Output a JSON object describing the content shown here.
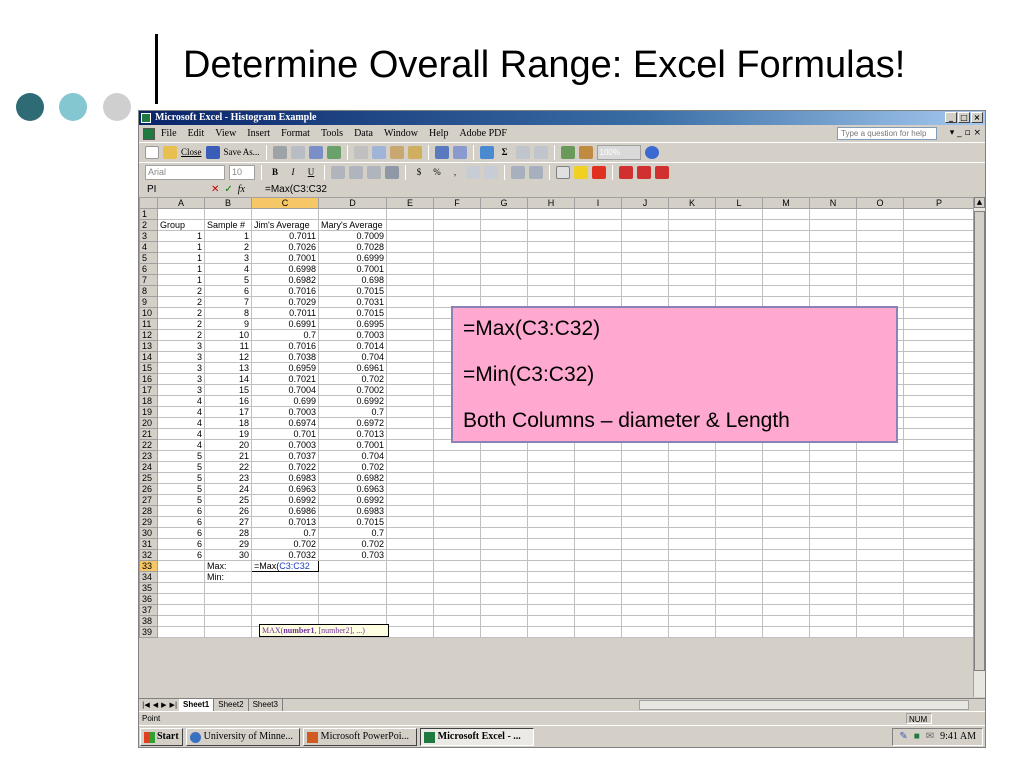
{
  "slide": {
    "title": "Determine Overall Range: Excel Formulas!",
    "dot_colors": [
      "#2e6b74",
      "#85c7d0",
      "#cfcfcf"
    ]
  },
  "window": {
    "title": "Microsoft Excel - Histogram Example",
    "controls": [
      "_",
      "□",
      "×"
    ]
  },
  "menu": {
    "items": [
      "File",
      "Edit",
      "View",
      "Insert",
      "Format",
      "Tools",
      "Data",
      "Window",
      "Help",
      "Adobe PDF"
    ],
    "help_placeholder": "Type a question for help"
  },
  "toolbar": {
    "close_label": "Close",
    "saveas_label": "Save As...",
    "zoom": "100%",
    "font_name": "Arial",
    "font_size": "10",
    "bold": "B",
    "italic": "I",
    "underline": "U",
    "currency": "$",
    "percent": "%",
    "comma": ",",
    "sum": "Σ"
  },
  "formula_bar": {
    "name_box": "PI",
    "fx": "fx",
    "formula": "=Max(C3:C32"
  },
  "grid": {
    "columns": [
      "A",
      "B",
      "C",
      "D",
      "E",
      "F",
      "G",
      "H",
      "I",
      "J",
      "K",
      "L",
      "M",
      "N",
      "O",
      "P"
    ],
    "headers": [
      "Group",
      "Sample #",
      "Jim's Average",
      "Mary's Average"
    ],
    "rows": [
      [
        "1",
        "1",
        "0.7011",
        "0.7009"
      ],
      [
        "1",
        "2",
        "0.7026",
        "0.7028"
      ],
      [
        "1",
        "3",
        "0.7001",
        "0.6999"
      ],
      [
        "1",
        "4",
        "0.6998",
        "0.7001"
      ],
      [
        "1",
        "5",
        "0.6982",
        "0.698"
      ],
      [
        "2",
        "6",
        "0.7016",
        "0.7015"
      ],
      [
        "2",
        "7",
        "0.7029",
        "0.7031"
      ],
      [
        "2",
        "8",
        "0.7011",
        "0.7015"
      ],
      [
        "2",
        "9",
        "0.6991",
        "0.6995"
      ],
      [
        "2",
        "10",
        "0.7",
        "0.7003"
      ],
      [
        "3",
        "11",
        "0.7016",
        "0.7014"
      ],
      [
        "3",
        "12",
        "0.7038",
        "0.704"
      ],
      [
        "3",
        "13",
        "0.6959",
        "0.6961"
      ],
      [
        "3",
        "14",
        "0.7021",
        "0.702"
      ],
      [
        "3",
        "15",
        "0.7004",
        "0.7002"
      ],
      [
        "4",
        "16",
        "0.699",
        "0.6992"
      ],
      [
        "4",
        "17",
        "0.7003",
        "0.7"
      ],
      [
        "4",
        "18",
        "0.6974",
        "0.6972"
      ],
      [
        "4",
        "19",
        "0.701",
        "0.7013"
      ],
      [
        "4",
        "20",
        "0.7003",
        "0.7001"
      ],
      [
        "5",
        "21",
        "0.7037",
        "0.704"
      ],
      [
        "5",
        "22",
        "0.7022",
        "0.702"
      ],
      [
        "5",
        "23",
        "0.6983",
        "0.6982"
      ],
      [
        "5",
        "24",
        "0.6963",
        "0.6963"
      ],
      [
        "5",
        "25",
        "0.6992",
        "0.6992"
      ],
      [
        "6",
        "26",
        "0.6986",
        "0.6983"
      ],
      [
        "6",
        "27",
        "0.7013",
        "0.7015"
      ],
      [
        "6",
        "28",
        "0.7",
        "0.7"
      ],
      [
        "6",
        "29",
        "0.702",
        "0.702"
      ],
      [
        "6",
        "30",
        "0.7032",
        "0.703"
      ]
    ],
    "max_label": "Max:",
    "min_label": "Min:",
    "editing_prefix": "=Max(",
    "editing_ref": "C3:C32",
    "row_count": 39
  },
  "tooltip": {
    "fn": "MAX(",
    "arg1": "number1",
    "rest": ", [number2], ...)"
  },
  "sheets": {
    "tabs": [
      "Sheet1",
      "Sheet2",
      "Sheet3"
    ],
    "active": "Sheet1"
  },
  "status": {
    "mode": "Point",
    "num": "NUM"
  },
  "taskbar": {
    "start": "Start",
    "buttons": [
      "University of Minne...",
      "Microsoft PowerPoi...",
      "Microsoft Excel - ..."
    ],
    "clock": "9:41 AM"
  },
  "callout": {
    "lines": [
      "=Max(C3:C32)",
      "=Min(C3:C32)",
      "Both Columns – diameter & Length"
    ]
  }
}
